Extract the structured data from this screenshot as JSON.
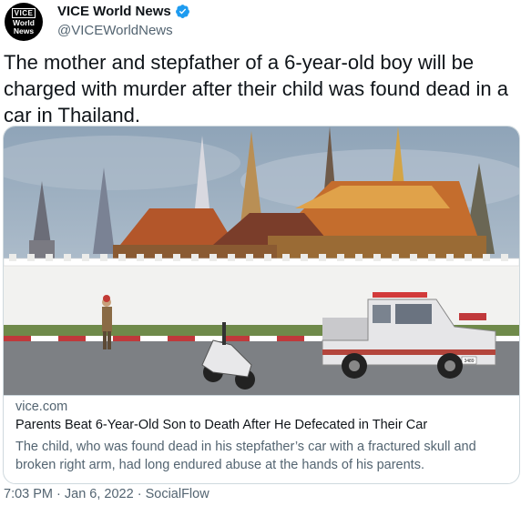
{
  "account": {
    "display_name": "VICE World News",
    "handle": "@VICEWorldNews",
    "avatar_text_top": "VICE",
    "avatar_text_mid": "World",
    "avatar_text_bottom": "News"
  },
  "tweet": {
    "text": "The mother and stepfather of a 6-year-old boy will be charged with murder after their child was found dead in a car in Thailand."
  },
  "card": {
    "domain": "vice.com",
    "title": "Parents Beat 6-Year-Old Son to Death After He Defecated in Their Car",
    "description": "The child, who was found dead in his stepfather’s car with a fractured skull and broken right arm, had long endured abuse at the hands of his parents.",
    "police_car_plate": "3489"
  },
  "meta": {
    "time": "7:03 PM",
    "separator": " · ",
    "date": "Jan 6, 2022",
    "source": "SocialFlow"
  },
  "colors": {
    "text_primary": "#0f1419",
    "text_secondary": "#536471",
    "verified_blue": "#1d9bf0",
    "border": "#cfd9de"
  },
  "icons": {
    "verified": "verified-badge-icon"
  }
}
